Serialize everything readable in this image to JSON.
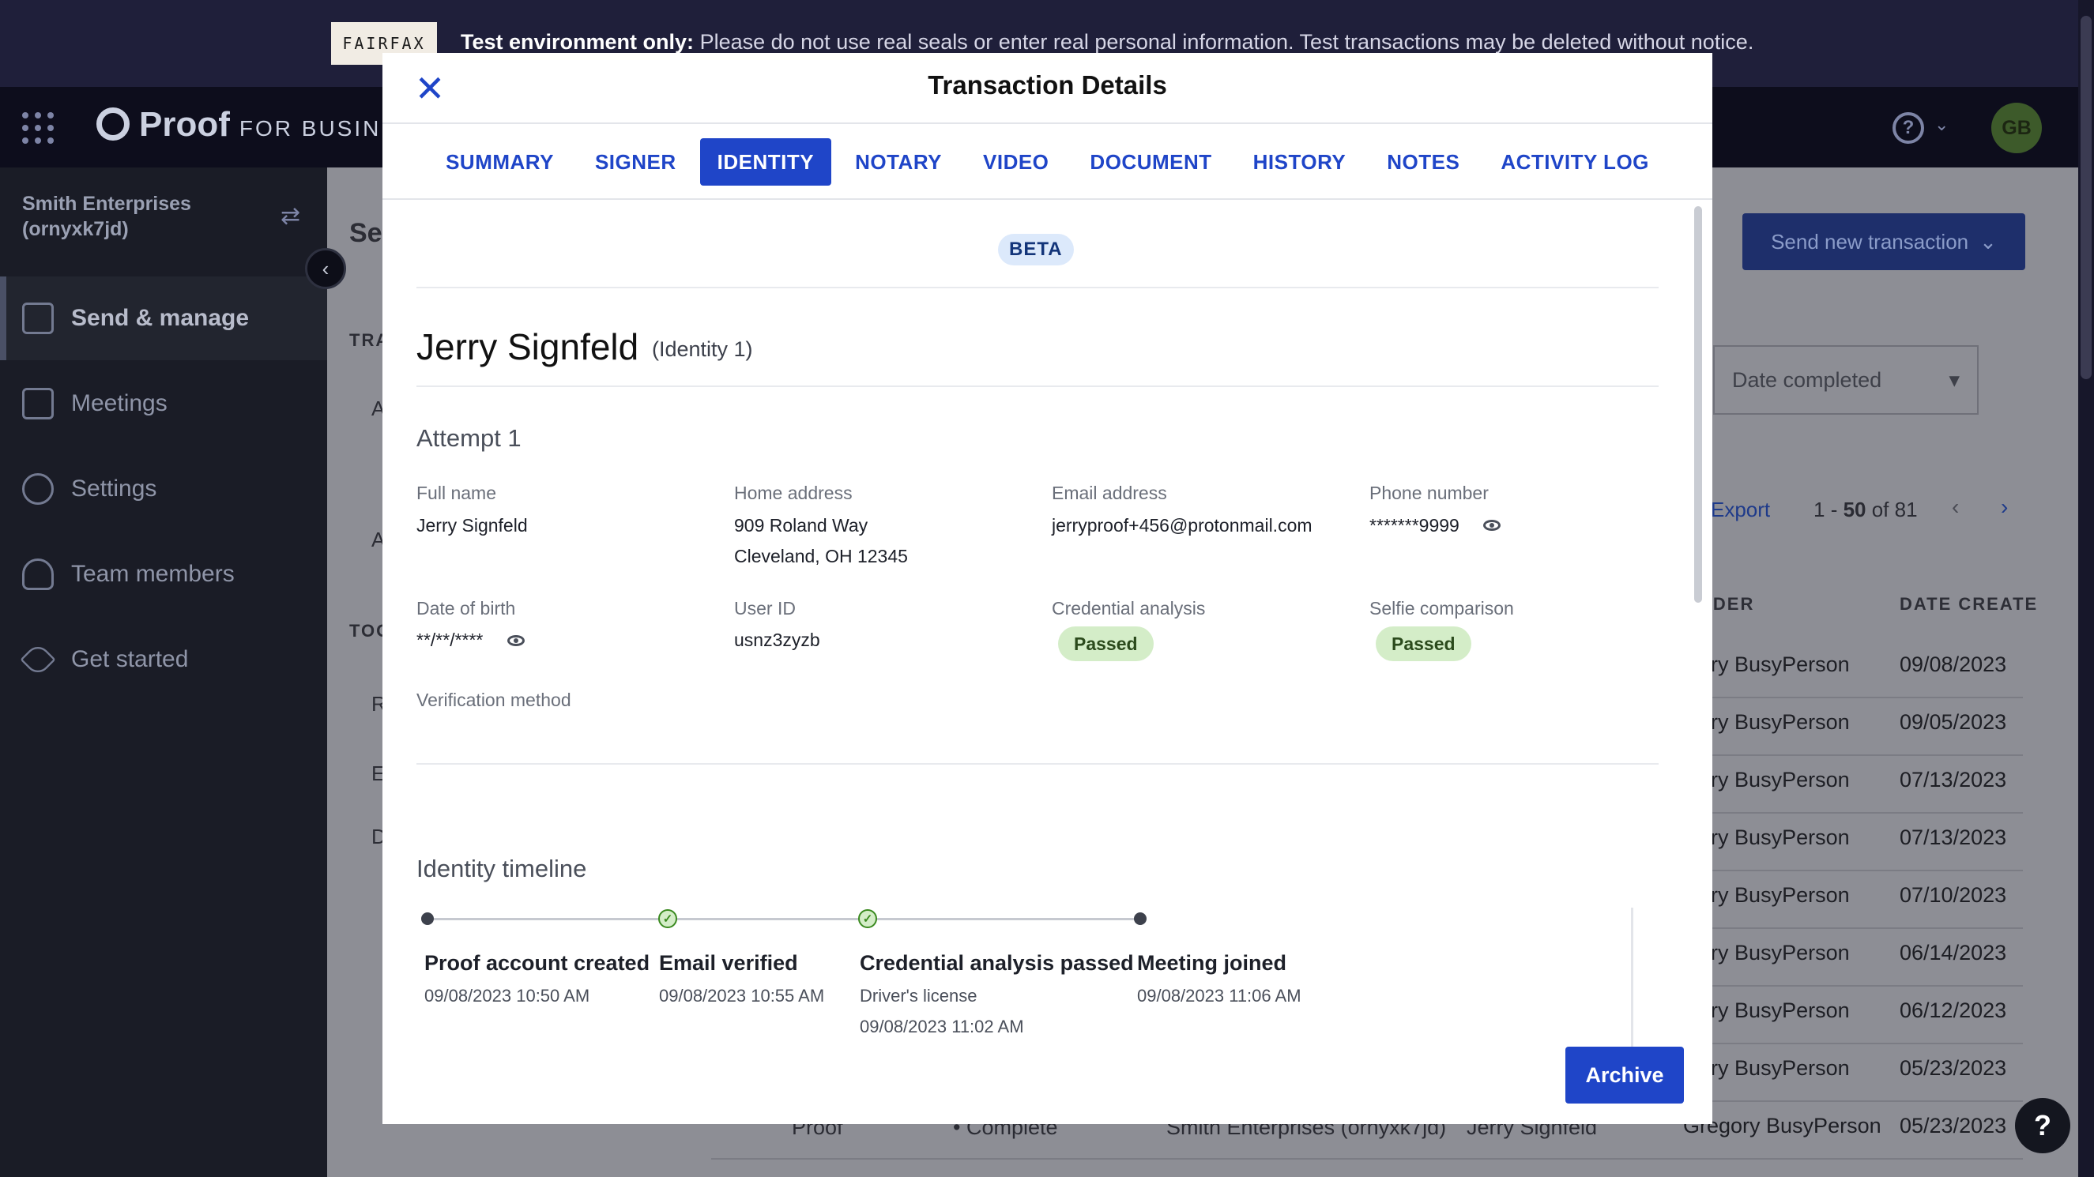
{
  "banner": {
    "logo": "FAIRFAX",
    "bold": "Test environment only:",
    "message": "Please do not use real seals or enter real personal information. Test transactions may be deleted without notice."
  },
  "topbar": {
    "brand_name": "Proof",
    "brand_sub": "FOR BUSINES",
    "avatar_initials": "GB",
    "help_glyph": "?"
  },
  "sidebar": {
    "org_name": "Smith Enterprises",
    "org_id": "(ornyxk7jd)",
    "items": [
      {
        "label": "Send & manage"
      },
      {
        "label": "Meetings"
      },
      {
        "label": "Settings"
      },
      {
        "label": "Team members"
      },
      {
        "label": "Get started"
      }
    ]
  },
  "background": {
    "page_title_fragment": "Se",
    "section_tra": "TRA",
    "section_too": "TOO",
    "left_fragments": [
      "A",
      "A",
      "R",
      "E",
      "D"
    ],
    "send_button": "Send new transaction",
    "date_select": "Date completed",
    "export": "Export",
    "pagination": {
      "start": "1",
      "end": "50",
      "total": "81"
    },
    "columns": [
      "NDER",
      "DATE CREATE"
    ],
    "rows": [
      {
        "sender": "egory BusyPerson",
        "date": "09/08/2023"
      },
      {
        "sender": "egory BusyPerson",
        "date": "09/05/2023"
      },
      {
        "sender": "egory BusyPerson",
        "date": "07/13/2023"
      },
      {
        "sender": "egory BusyPerson",
        "date": "07/13/2023"
      },
      {
        "sender": "egory BusyPerson",
        "date": "07/10/2023"
      },
      {
        "sender": "egory BusyPerson",
        "date": "06/14/2023"
      },
      {
        "sender": "egory BusyPerson",
        "date": "06/12/2023"
      },
      {
        "sender": "egory BusyPerson",
        "date": "05/23/2023"
      },
      {
        "sender": "Gregory BusyPerson",
        "date": "05/23/2023"
      }
    ],
    "last_row": {
      "type": "Proof",
      "status": "Complete",
      "org": "Smith Enterprises (ornyxk7jd)",
      "signer": "Jerry Signfeld"
    }
  },
  "modal": {
    "title": "Transaction Details",
    "tabs": [
      {
        "label": "SUMMARY",
        "active": false
      },
      {
        "label": "SIGNER",
        "active": false
      },
      {
        "label": "IDENTITY",
        "active": true
      },
      {
        "label": "NOTARY",
        "active": false
      },
      {
        "label": "VIDEO",
        "active": false
      },
      {
        "label": "DOCUMENT",
        "active": false
      },
      {
        "label": "HISTORY",
        "active": false
      },
      {
        "label": "NOTES",
        "active": false
      },
      {
        "label": "ACTIVITY LOG",
        "active": false
      }
    ],
    "beta_badge": "BETA",
    "identity": {
      "name": "Jerry Signfeld",
      "tag": "(Identity 1)",
      "attempt_title": "Attempt 1",
      "fields": {
        "full_name": {
          "label": "Full name",
          "value": "Jerry Signfeld"
        },
        "home_address": {
          "label": "Home address",
          "line1": "909 Roland Way",
          "line2": "Cleveland, OH 12345"
        },
        "email": {
          "label": "Email address",
          "value": "jerryproof+456@protonmail.com"
        },
        "phone": {
          "label": "Phone number",
          "value": "*******9999"
        },
        "dob": {
          "label": "Date of birth",
          "value": "**/**/****"
        },
        "user_id": {
          "label": "User ID",
          "value": "usnz3zyzb"
        },
        "credential": {
          "label": "Credential analysis",
          "value": "Passed"
        },
        "selfie": {
          "label": "Selfie comparison",
          "value": "Passed"
        },
        "verification": {
          "label": "Verification method",
          "value": ""
        }
      }
    },
    "timeline": {
      "title": "Identity timeline",
      "events": [
        {
          "title": "Proof account created",
          "lines": [
            "09/08/2023 10:50 AM"
          ],
          "status": "dot"
        },
        {
          "title": "Email verified",
          "lines": [
            "09/08/2023 10:55 AM"
          ],
          "status": "check"
        },
        {
          "title": "Credential analysis passed",
          "lines": [
            "Driver's license",
            "09/08/2023 11:02 AM"
          ],
          "status": "check"
        },
        {
          "title": "Meeting joined",
          "lines": [
            "09/08/2023 11:06 AM"
          ],
          "status": "dot"
        }
      ]
    },
    "archive_button": "Archive"
  },
  "help_fab": "?"
}
